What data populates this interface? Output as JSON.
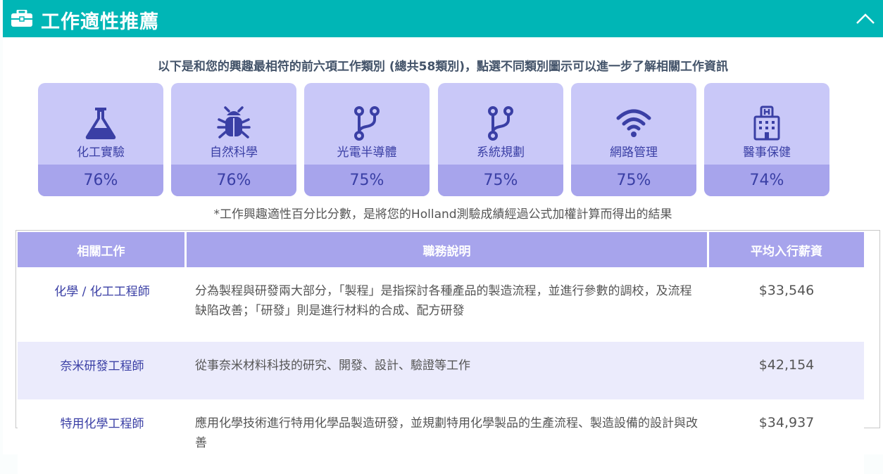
{
  "header": {
    "title": "工作適性推薦"
  },
  "intro": "以下是和您的興趣最相符的前六項工作類別 (總共58類別)，點選不同類別圖示可以進一步了解相關工作資訊",
  "cards": [
    {
      "label": "化工實驗",
      "percent": "76%",
      "icon": "flask-icon"
    },
    {
      "label": "自然科學",
      "percent": "76%",
      "icon": "bug-icon"
    },
    {
      "label": "光電半導體",
      "percent": "75%",
      "icon": "branch-icon"
    },
    {
      "label": "系統規劃",
      "percent": "75%",
      "icon": "branch-icon"
    },
    {
      "label": "網路管理",
      "percent": "75%",
      "icon": "wifi-icon"
    },
    {
      "label": "醫事保健",
      "percent": "74%",
      "icon": "hospital-icon"
    }
  ],
  "note": "*工作興趣適性百分比分數，是將您的Holland測驗成績經過公式加權計算而得出的結果",
  "table": {
    "headers": [
      "相關工作",
      "職務說明",
      "平均入行薪資"
    ],
    "rows": [
      {
        "job": "化學 / 化工工程師",
        "desc": "分為製程與研發兩大部分，「製程」是指探討各種產品的製造流程，並進行參數的調校，及流程缺陷改善；「研發」則是進行材料的合成、配方研發",
        "salary": "$33,546"
      },
      {
        "job": "奈米研發工程師",
        "desc": "從事奈米材料科技的研究、開發、設計、驗證等工作",
        "salary": "$42,154"
      },
      {
        "job": "特用化學工程師",
        "desc": "應用化學技術進行特用化學品製造研發，並規劃特用化學製品的生產流程、製造設備的設計與改善",
        "salary": "$34,937"
      }
    ]
  },
  "colors": {
    "header": "#00b6b6",
    "card": "#c9c8f8",
    "card_pct": "#a7a4ec",
    "accent": "#3a3fa5"
  }
}
